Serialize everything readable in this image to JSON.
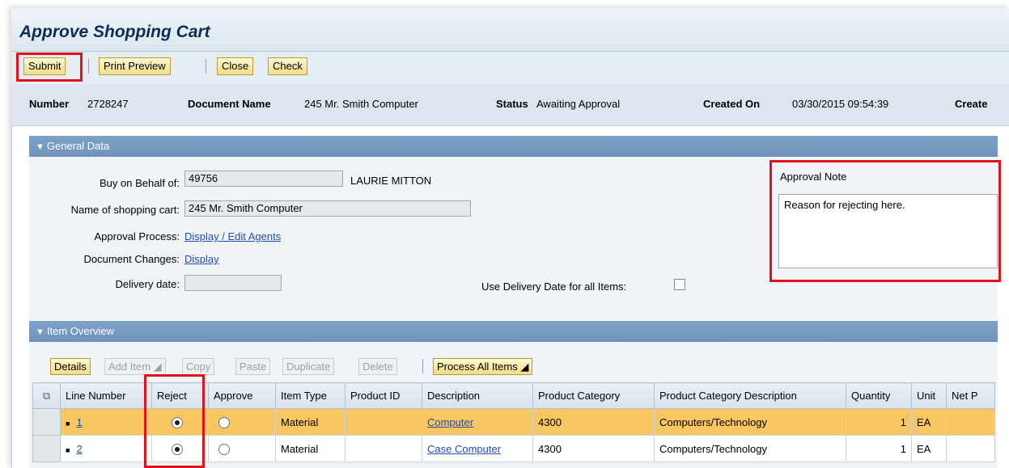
{
  "window": {
    "title": "Approve Shopping Cart"
  },
  "toolbar": {
    "submit": "Submit",
    "print_preview": "Print Preview",
    "close": "Close",
    "check": "Check"
  },
  "header": {
    "number_label": "Number",
    "number_value": "2728247",
    "docname_label": "Document Name",
    "docname_value": "245 Mr. Smith Computer",
    "status_label": "Status",
    "status_value": "Awaiting Approval",
    "created_label": "Created On",
    "created_value": "03/30/2015 09:54:39",
    "created_by_label": "Create"
  },
  "general": {
    "section_title": "General Data",
    "buy_on_behalf_label": "Buy on Behalf of:",
    "buy_on_behalf_value": "49756",
    "buy_on_behalf_name": "LAURIE MITTON",
    "cart_name_label": "Name of shopping cart:",
    "cart_name_value": "245 Mr. Smith Computer",
    "approval_process_label": "Approval Process:",
    "approval_process_link": "Display / Edit Agents",
    "doc_changes_label": "Document Changes:",
    "doc_changes_link": "Display",
    "delivery_label": "Delivery date:",
    "delivery_value": "",
    "use_delivery_label": "Use Delivery Date for all Items:",
    "approval_note_label": "Approval Note",
    "approval_note_value": "Reason for rejecting here."
  },
  "items": {
    "section_title": "Item Overview",
    "buttons": {
      "details": "Details",
      "add_item": "Add Item",
      "copy": "Copy",
      "paste": "Paste",
      "duplicate": "Duplicate",
      "delete": "Delete",
      "process_all": "Process All Items"
    },
    "columns": [
      "Line Number",
      "Reject",
      "Approve",
      "Item Type",
      "Product ID",
      "Description",
      "Product Category",
      "Product Category Description",
      "Quantity",
      "Unit",
      "Net P"
    ],
    "rows": [
      {
        "line": "1",
        "item_type": "Material",
        "product_id": "",
        "description": "Computer",
        "category": "4300",
        "category_desc": "Computers/Technology",
        "quantity": "1",
        "unit": "EA",
        "reject": true,
        "approve": false,
        "selected": true
      },
      {
        "line": "2",
        "item_type": "Material",
        "product_id": "",
        "description": "Case Computer",
        "category": "4300",
        "category_desc": "Computers/Technology",
        "quantity": "1",
        "unit": "EA",
        "reject": true,
        "approve": false,
        "selected": false
      }
    ]
  },
  "colors": {
    "section_header": "#7fa2c7",
    "selected_row": "#fac661",
    "highlight_box": "#e2101a",
    "button_yellow": "#f1dd86",
    "link": "#1f4fa8"
  }
}
